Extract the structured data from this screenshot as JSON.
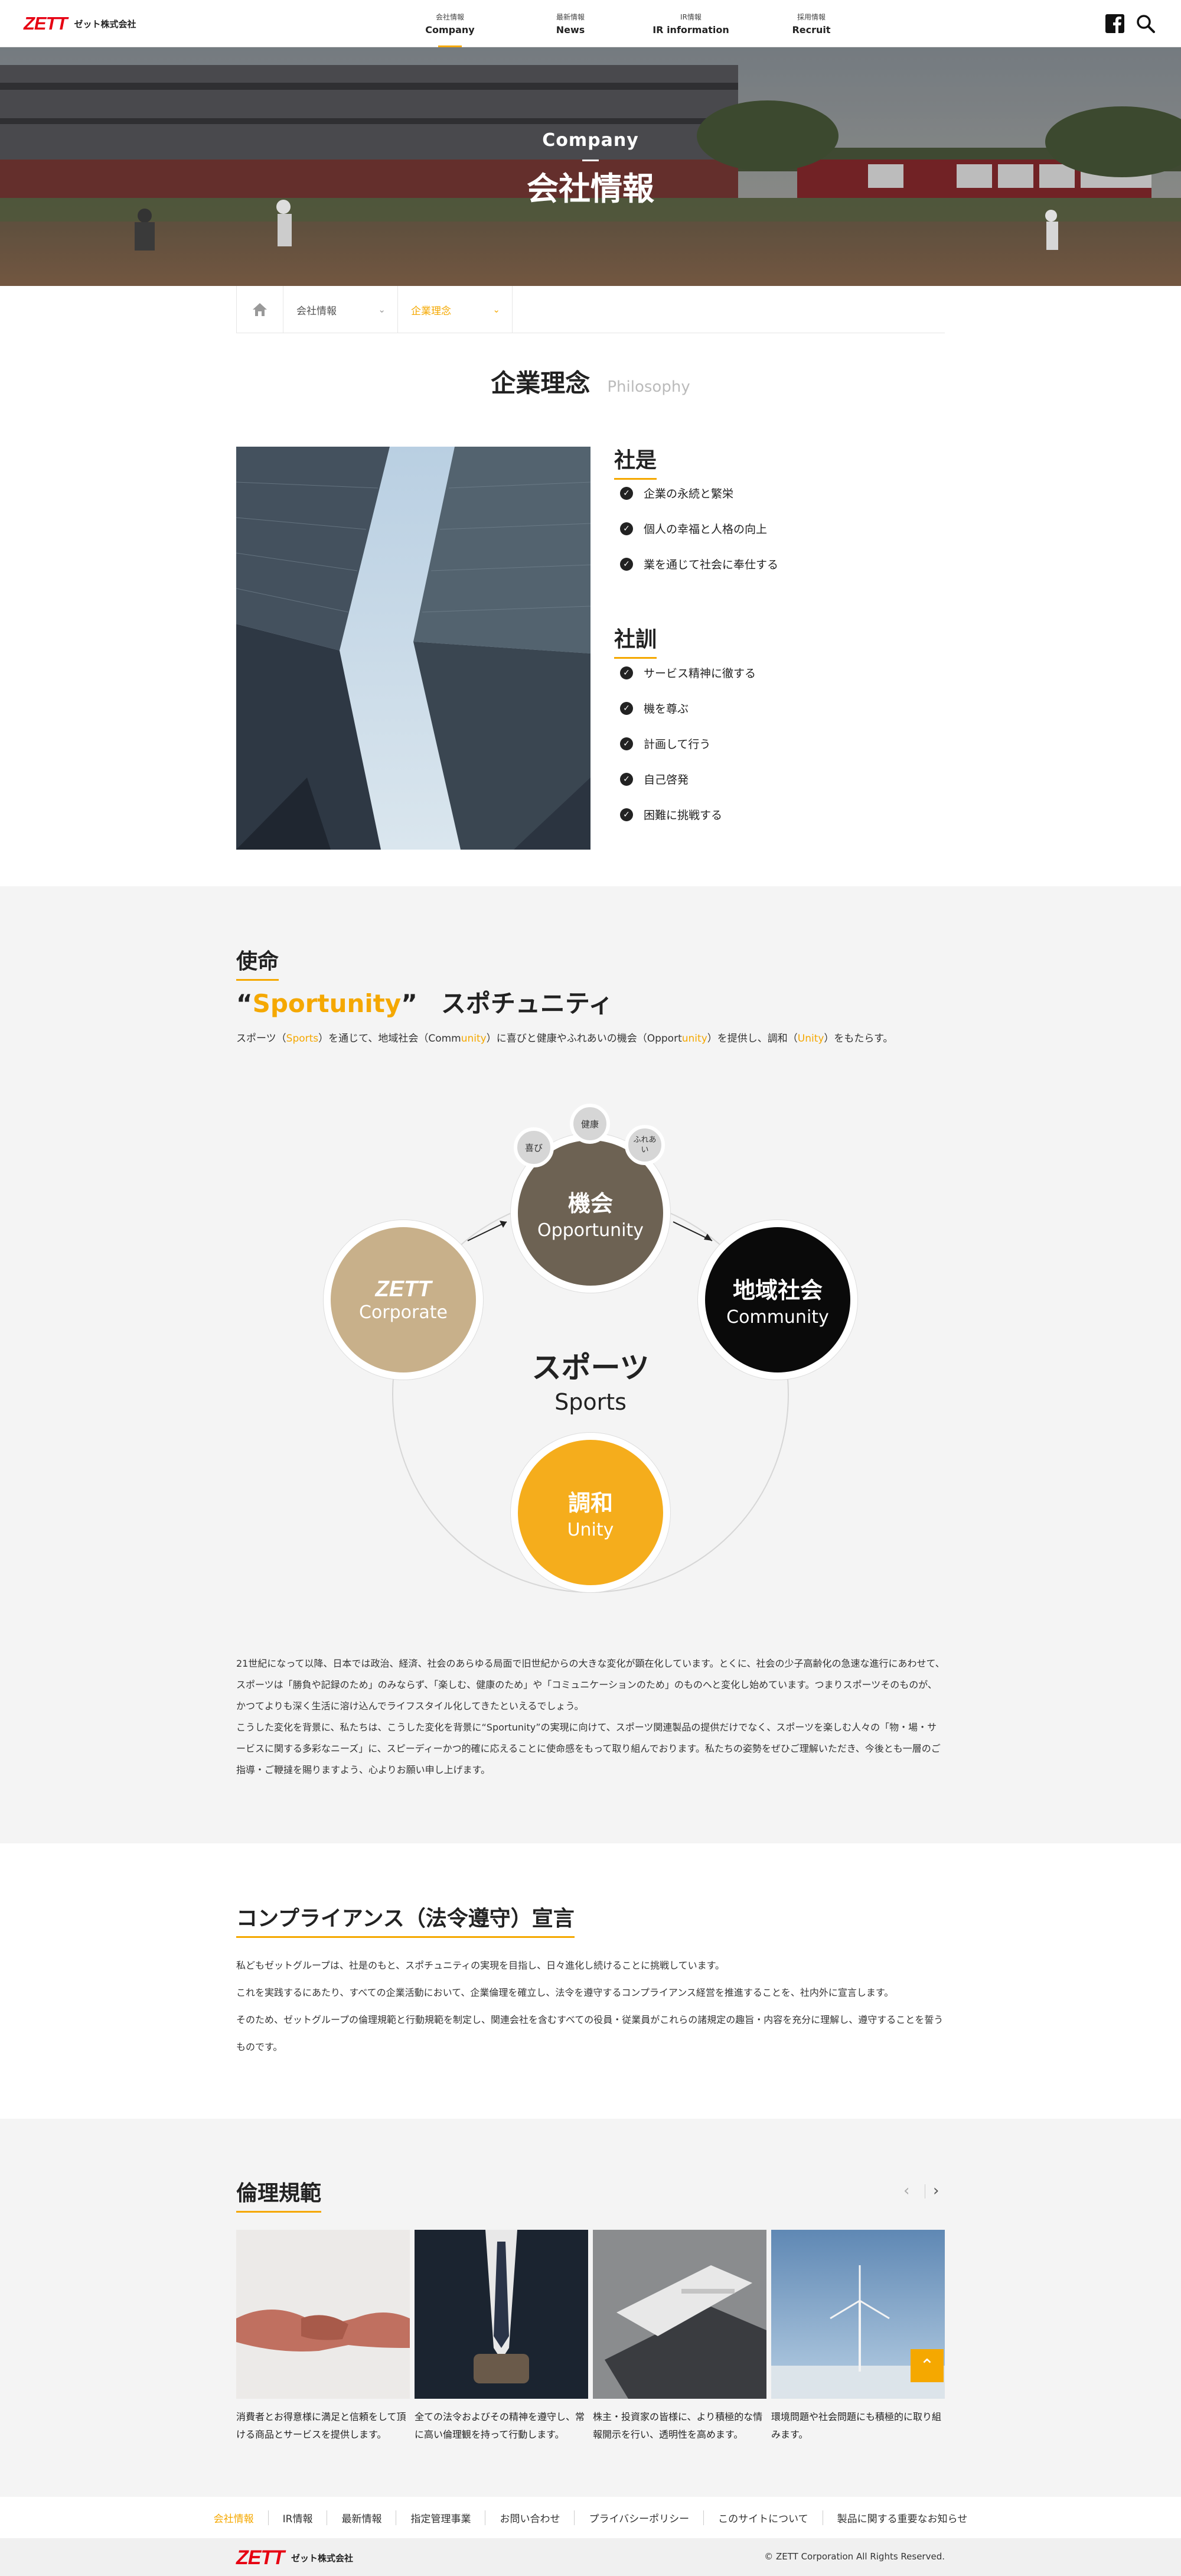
{
  "header": {
    "logo": "ZETT",
    "company": "ゼット株式会社",
    "nav": [
      {
        "jp": "会社情報",
        "en": "Company"
      },
      {
        "jp": "最新情報",
        "en": "News"
      },
      {
        "jp": "IR情報",
        "en": "IR information"
      },
      {
        "jp": "採用情報",
        "en": "Recruit"
      }
    ],
    "icons": [
      "facebook-icon",
      "search-icon"
    ]
  },
  "hero": {
    "en": "Company",
    "jp": "会社情報"
  },
  "breadcrumb": {
    "items": [
      "会社情報",
      "企業理念"
    ]
  },
  "philosophy": {
    "title": "企業理念",
    "subtitle": "Philosophy",
    "shaze_title": "社是",
    "shaze": [
      "企業の永続と繁栄",
      "個人の幸福と人格の向上",
      "業を通じて社会に奉仕する"
    ],
    "shakun_title": "社訓",
    "shakun": [
      "サービス精神に徹する",
      "機を尊ぶ",
      "計画して行う",
      "自己啓発",
      "困難に挑戦する"
    ]
  },
  "mission": {
    "title": "使命",
    "slogan_open": "“",
    "slogan": "Sportunity",
    "slogan_close": "”",
    "slogan_jp": "スポチュニティ",
    "desc_parts": [
      "スポーツ（",
      "Sports",
      "）を通じて、地域社会（Comm",
      "unity",
      "）に喜びと健康やふれあいの機会（Opport",
      "unity",
      "）を提供し、調和（",
      "Unity",
      "）をもたらす。"
    ]
  },
  "diagram": {
    "center_jp": "スポーツ",
    "center_en": "Sports",
    "corporate": {
      "logo": "ZETT",
      "en": "Corporate"
    },
    "opportunity": {
      "jp": "機会",
      "en": "Opportunity"
    },
    "community": {
      "jp": "地域社会",
      "en": "Community"
    },
    "unity": {
      "jp": "調和",
      "en": "Unity"
    },
    "small": [
      "喜び",
      "健康",
      "ふれあい"
    ],
    "colors": {
      "corporate": "#c8b08a",
      "opportunity": "#6d6253",
      "community": "#0a0a0a",
      "unity": "#f5ad1c"
    }
  },
  "mission_text": [
    "21世紀になって以降、日本では政治、経済、社会のあらゆる局面で旧世紀からの大きな変化が顕在化しています。とくに、社会の少子高齢化の急速な進行にあわせて、スポーツは「勝負や記録のため」のみならず、「楽しむ、健康のため」や「コミュニケーションのため」のものへと変化し始めています。つまりスポーツそのものが、かつてよりも深く生活に溶け込んでライフスタイル化してきたといえるでしょう。",
    "こうした変化を背景に、私たちは、こうした変化を背景に“Sportunity”の実現に向けて、スポーツ関連製品の提供だけでなく、スポーツを楽しむ人々の「物・場・サービスに関する多彩なニーズ」に、スピーディーかつ的確に応えることに使命感をもって取り組んでおります。私たちの姿勢をぜひご理解いただき、今後とも一層のご指導・ご鞭撻を賜りますよう、心よりお願い申し上げます。"
  ],
  "compliance": {
    "title": "コンプライアンス（法令遵守）宣言",
    "lines": [
      "私どもゼットグループは、社是のもと、スポチュニティの実現を目指し、日々進化し続けることに挑戦しています。",
      "これを実践するにあたり、すべての企業活動において、企業倫理を確立し、法令を遵守するコンプライアンス経営を推進することを、社内外に宣言します。",
      "そのため、ゼットグループの倫理規範と行動規範を制定し、関連会社を含むすべての役員・従業員がこれらの諸規定の趣旨・内容を充分に理解し、遵守することを誓うものです。"
    ]
  },
  "ethics": {
    "title": "倫理規範",
    "cards": [
      "消費者とお得意様に満足と信頼をして頂ける商品とサービスを提供します。",
      "全ての法令およびその精神を遵守し、常に高い倫理観を持って行動します。",
      "株主・投資家の皆様に、より積極的な情報開示を行い、透明性を高めます。",
      "環境問題や社会問題にも積極的に取り組みます。"
    ]
  },
  "footer": {
    "nav": [
      "会社情報",
      "IR情報",
      "最新情報",
      "指定管理事業",
      "お問い合わせ",
      "プライバシーポリシー",
      "このサイトについて",
      "製品に関する重要なお知らせ"
    ],
    "logo": "ZETT",
    "company": "ゼット株式会社",
    "copyright": "© ZETT Corporation All Rights Reserved."
  }
}
